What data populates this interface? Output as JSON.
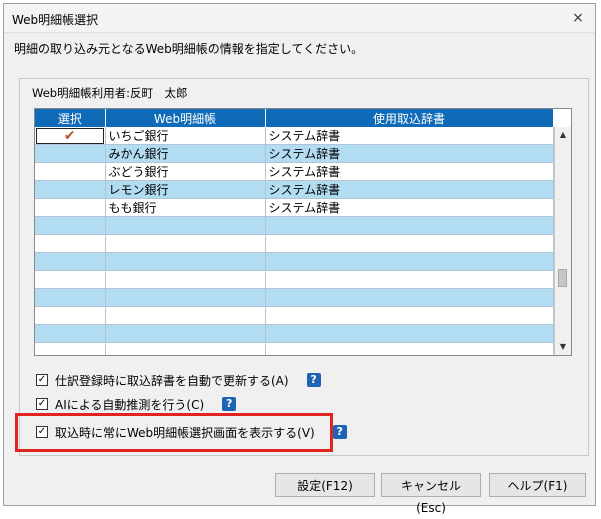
{
  "dialog": {
    "title": "Web明細帳選択",
    "close_icon": "×",
    "instruction": "明細の取り込み元となるWeb明細帳の情報を指定してください。"
  },
  "panel": {
    "user_label": "Web明細帳利用者:反町　太郎",
    "columns": [
      "選択",
      "Web明細帳",
      "使用取込辞書"
    ],
    "rows": [
      {
        "selected": "✔",
        "name": "いちご銀行",
        "dictionary": "システム辞書"
      },
      {
        "selected": "",
        "name": "みかん銀行",
        "dictionary": "システム辞書"
      },
      {
        "selected": "",
        "name": "ぶどう銀行",
        "dictionary": "システム辞書"
      },
      {
        "selected": "",
        "name": "レモン銀行",
        "dictionary": "システム辞書"
      },
      {
        "selected": "",
        "name": "もも銀行",
        "dictionary": "システム辞書"
      },
      {
        "selected": "",
        "name": "",
        "dictionary": ""
      },
      {
        "selected": "",
        "name": "",
        "dictionary": ""
      },
      {
        "selected": "",
        "name": "",
        "dictionary": ""
      },
      {
        "selected": "",
        "name": "",
        "dictionary": ""
      },
      {
        "selected": "",
        "name": "",
        "dictionary": ""
      },
      {
        "selected": "",
        "name": "",
        "dictionary": ""
      },
      {
        "selected": "",
        "name": "",
        "dictionary": ""
      },
      {
        "selected": "",
        "name": "",
        "dictionary": ""
      }
    ],
    "scroll_up_icon": "▲",
    "scroll_down_icon": "▼"
  },
  "options": [
    {
      "label": "仕訳登録時に取込辞書を自動で更新する(A)",
      "checked": "✓",
      "help": "?"
    },
    {
      "label": "AIによる自動推測を行う(C)",
      "checked": "✓",
      "help": "?"
    },
    {
      "label": "取込時に常にWeb明細帳選択画面を表示する(V)",
      "checked": "✓",
      "help": "?"
    }
  ],
  "buttons": {
    "settings": "設定(F12)",
    "cancel": "キャンセル(Esc)",
    "help": "ヘルプ(F1)"
  },
  "colors": {
    "header_bg": "#0f6bb8",
    "alt_row": "#b2dcf2",
    "check_mark": "#b5532a",
    "highlight": "#e0241f",
    "help_icon": "#1e64b4"
  }
}
